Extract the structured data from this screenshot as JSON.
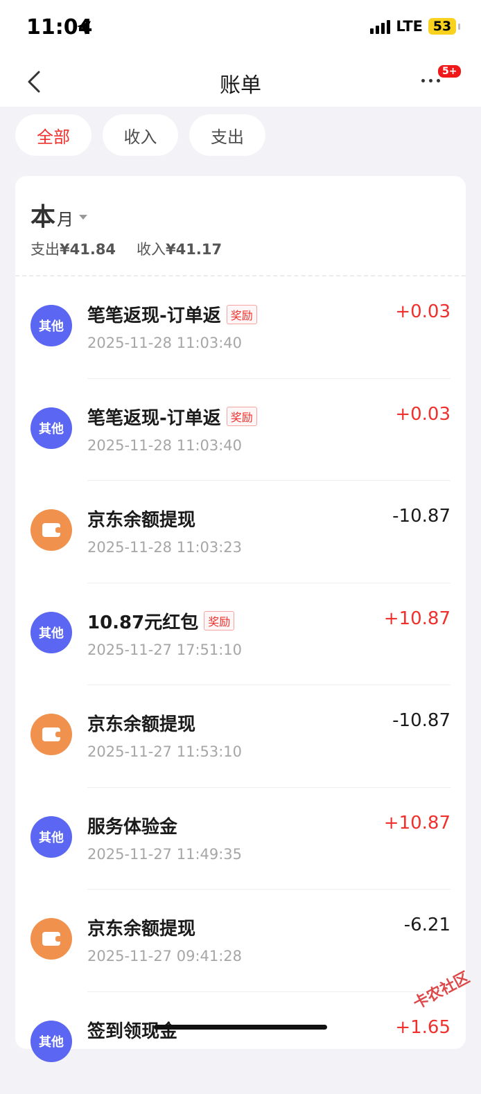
{
  "status_bar": {
    "time": "11:04",
    "network": "LTE",
    "battery": "53"
  },
  "nav": {
    "title": "账单",
    "badge": "5+"
  },
  "filters": {
    "all": "全部",
    "income": "收入",
    "expense": "支出"
  },
  "summary": {
    "month_big": "本",
    "month_small": "月",
    "expense_label": "支出",
    "expense_amount": "¥41.84",
    "income_label": "收入",
    "income_amount": "¥41.17"
  },
  "transactions": [
    {
      "icon": "其他",
      "type": "other",
      "title": "笔笔返现-订单返",
      "tag": "奖励",
      "time": "2025-11-28 11:03:40",
      "amount": "+0.03",
      "sign": "pos"
    },
    {
      "icon": "其他",
      "type": "other",
      "title": "笔笔返现-订单返",
      "tag": "奖励",
      "time": "2025-11-28 11:03:40",
      "amount": "+0.03",
      "sign": "pos"
    },
    {
      "icon": "",
      "type": "wallet",
      "title": "京东余额提现",
      "tag": "",
      "time": "2025-11-28 11:03:23",
      "amount": "-10.87",
      "sign": "neg"
    },
    {
      "icon": "其他",
      "type": "other",
      "title": "10.87元红包",
      "tag": "奖励",
      "time": "2025-11-27 17:51:10",
      "amount": "+10.87",
      "sign": "pos"
    },
    {
      "icon": "",
      "type": "wallet",
      "title": "京东余额提现",
      "tag": "",
      "time": "2025-11-27 11:53:10",
      "amount": "-10.87",
      "sign": "neg"
    },
    {
      "icon": "其他",
      "type": "other",
      "title": "服务体验金",
      "tag": "",
      "time": "2025-11-27 11:49:35",
      "amount": "+10.87",
      "sign": "pos"
    },
    {
      "icon": "",
      "type": "wallet",
      "title": "京东余额提现",
      "tag": "",
      "time": "2025-11-27 09:41:28",
      "amount": "-6.21",
      "sign": "neg"
    },
    {
      "icon": "其他",
      "type": "other",
      "title": "签到领现金",
      "tag": "",
      "time": "",
      "amount": "+1.65",
      "sign": "pos"
    }
  ],
  "watermark": "卡农社区",
  "colors": {
    "accent": "#f0302c",
    "other_icon": "#5b67f2",
    "wallet_icon": "#f0924d"
  }
}
